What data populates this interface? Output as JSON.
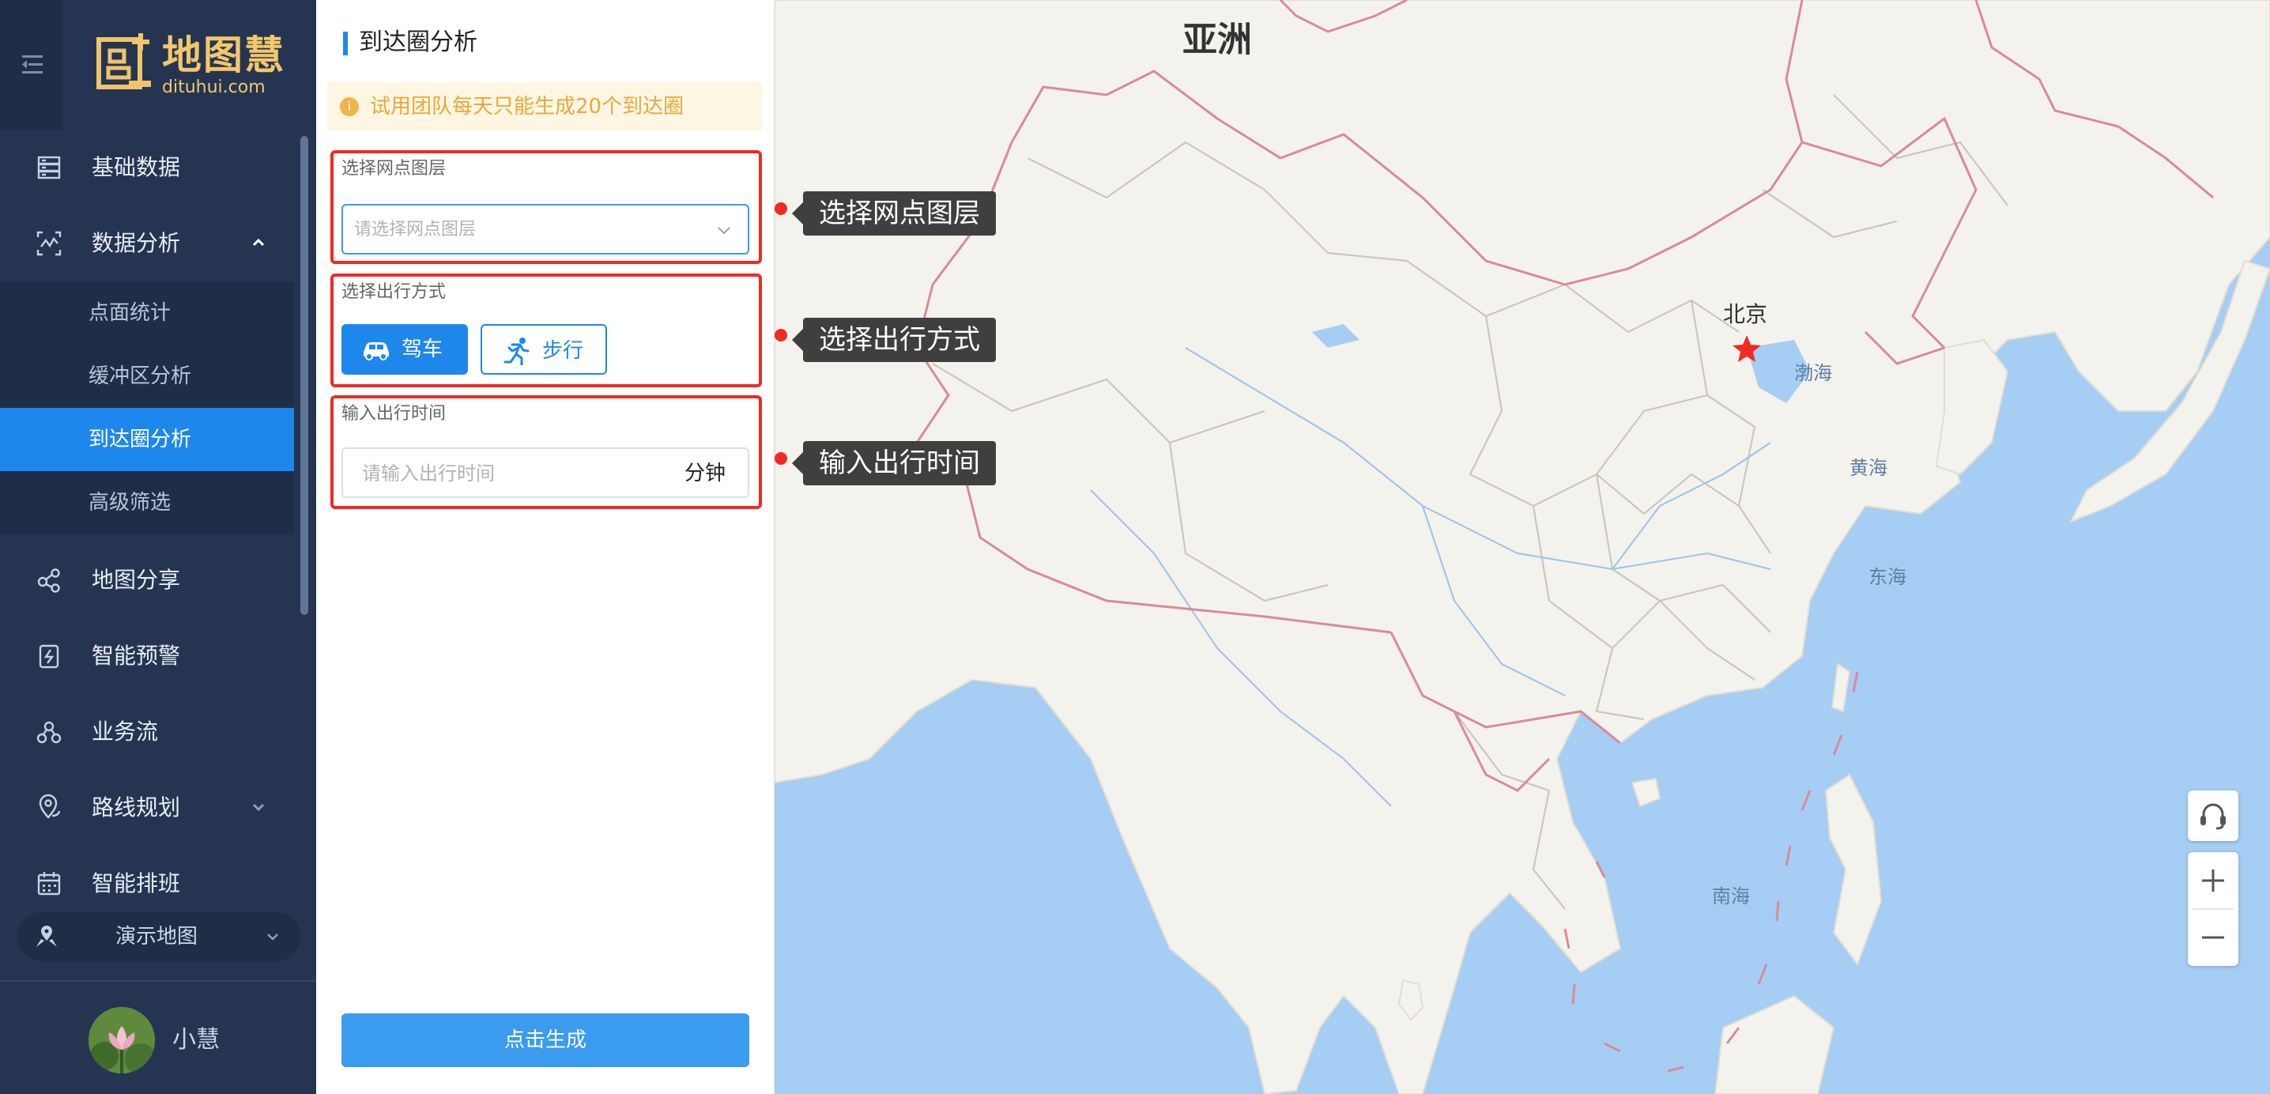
{
  "sidebar": {
    "logo_text": "地图慧",
    "logo_domain": "dituhui.com",
    "items": [
      {
        "label": "基础数据",
        "icon": "database-icon"
      },
      {
        "label": "数据分析",
        "icon": "analysis-icon",
        "expanded": true
      },
      {
        "label": "地图分享",
        "icon": "share-icon"
      },
      {
        "label": "智能预警",
        "icon": "alert-icon"
      },
      {
        "label": "业务流",
        "icon": "workflow-icon"
      },
      {
        "label": "路线规划",
        "icon": "route-icon",
        "has_submenu": true
      },
      {
        "label": "智能排班",
        "icon": "calendar-icon"
      }
    ],
    "subitems": [
      {
        "label": "点面统计"
      },
      {
        "label": "缓冲区分析"
      },
      {
        "label": "到达圈分析",
        "active": true
      },
      {
        "label": "高级筛选"
      }
    ],
    "demo_map_label": "演示地图",
    "user_name": "小慧"
  },
  "panel": {
    "title": "到达圈分析",
    "notice": "试用团队每天只能生成20个到达圈",
    "layer_label": "选择网点图层",
    "layer_placeholder": "请选择网点图层",
    "mode_label": "选择出行方式",
    "mode_drive": "驾车",
    "mode_walk": "步行",
    "time_label": "输入出行时间",
    "time_placeholder": "请输入出行时间",
    "time_unit": "分钟",
    "generate_button": "点击生成"
  },
  "map": {
    "continent_label": "亚洲",
    "city_label": "北京",
    "seas": [
      "渤海",
      "黄海",
      "东海",
      "南海"
    ],
    "callouts": [
      "选择网点图层",
      "选择出行方式",
      "输入出行时间"
    ],
    "colors": {
      "sea": "#a6cdf3",
      "land": "#f4f2ed",
      "border": "#d98a9a",
      "accent": "#1e87ec",
      "highlight": "#ef2b24"
    }
  }
}
